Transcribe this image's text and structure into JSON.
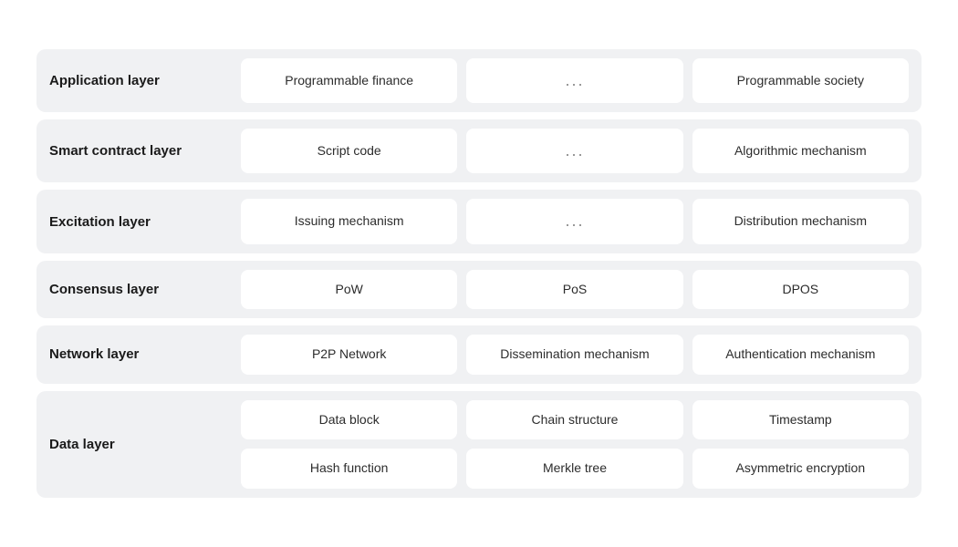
{
  "rows": [
    {
      "id": "application-layer",
      "label": "Application layer",
      "cells": [
        {
          "id": "programmable-finance",
          "text": "Programmable finance",
          "type": "normal"
        },
        {
          "id": "application-dots",
          "text": "...",
          "type": "dots"
        },
        {
          "id": "programmable-society",
          "text": "Programmable society",
          "type": "normal"
        }
      ],
      "layout": "standard"
    },
    {
      "id": "smart-contract-layer",
      "label": "Smart contract layer",
      "cells": [
        {
          "id": "script-code",
          "text": "Script code",
          "type": "normal"
        },
        {
          "id": "smart-contract-dots",
          "text": "...",
          "type": "dots"
        },
        {
          "id": "algorithmic-mechanism",
          "text": "Algorithmic mechanism",
          "type": "normal"
        }
      ],
      "layout": "standard"
    },
    {
      "id": "excitation-layer",
      "label": "Excitation layer",
      "cells": [
        {
          "id": "issuing-mechanism",
          "text": "Issuing mechanism",
          "type": "normal"
        },
        {
          "id": "excitation-dots",
          "text": "...",
          "type": "dots"
        },
        {
          "id": "distribution-mechanism",
          "text": "Distribution mechanism",
          "type": "normal"
        }
      ],
      "layout": "standard"
    },
    {
      "id": "consensus-layer",
      "label": "Consensus layer",
      "cells": [
        {
          "id": "pow",
          "text": "PoW",
          "type": "normal"
        },
        {
          "id": "pos",
          "text": "PoS",
          "type": "normal"
        },
        {
          "id": "dpos",
          "text": "DPOS",
          "type": "normal"
        }
      ],
      "layout": "standard"
    },
    {
      "id": "network-layer",
      "label": "Network layer",
      "cells": [
        {
          "id": "p2p-network",
          "text": "P2P Network",
          "type": "normal"
        },
        {
          "id": "dissemination-mechanism",
          "text": "Dissemination mechanism",
          "type": "normal"
        },
        {
          "id": "authentication-mechanism",
          "text": "Authentication mechanism",
          "type": "normal"
        }
      ],
      "layout": "standard"
    },
    {
      "id": "data-layer",
      "label": "Data layer",
      "cells": [
        {
          "id": "data-block",
          "text": "Data block",
          "type": "normal"
        },
        {
          "id": "chain-structure",
          "text": "Chain structure",
          "type": "normal"
        },
        {
          "id": "timestamp",
          "text": "Timestamp",
          "type": "normal"
        },
        {
          "id": "hash-function",
          "text": "Hash function",
          "type": "normal"
        },
        {
          "id": "merkle-tree",
          "text": "Merkle tree",
          "type": "normal"
        },
        {
          "id": "asymmetric-encryption",
          "text": "Asymmetric encryption",
          "type": "normal"
        }
      ],
      "layout": "double"
    }
  ]
}
